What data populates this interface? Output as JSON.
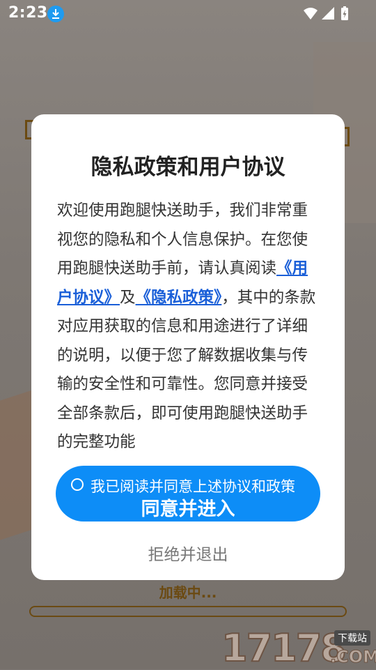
{
  "statusbar": {
    "time": "2:23",
    "icons": [
      "download-icon",
      "wifi-icon",
      "signal-icon",
      "battery-icon"
    ]
  },
  "background": {
    "loading_text": "加载中...",
    "progress": 0
  },
  "watermark": {
    "number": "17178",
    "domain": ".COM",
    "tag": "下载站"
  },
  "dialog": {
    "title": "隐私政策和用户协议",
    "body_before": "欢迎使用跑腿快送助手，我们非常重视您的隐私和个人信息保护。在您使用跑腿快送助手前，请认真阅读",
    "link_user_agreement": "《用户协议》",
    "conjunction": "及",
    "link_privacy_policy": "《隐私政策》",
    "body_after": "，其中的条款对应用获取的信息和用途进行了详细的说明，以便于您了解数据收集与传输的安全性和可靠性。您同意并接受全部条款后，即可使用跑腿快送助手的完整功能",
    "agree_note": "我已阅读并同意上述协议和政策",
    "agree_button": "同意并进入",
    "reject_button": "拒绝并退出"
  },
  "colors": {
    "accent": "#0d8df7",
    "link": "#1a5fd8",
    "loading": "#6b4a12"
  }
}
